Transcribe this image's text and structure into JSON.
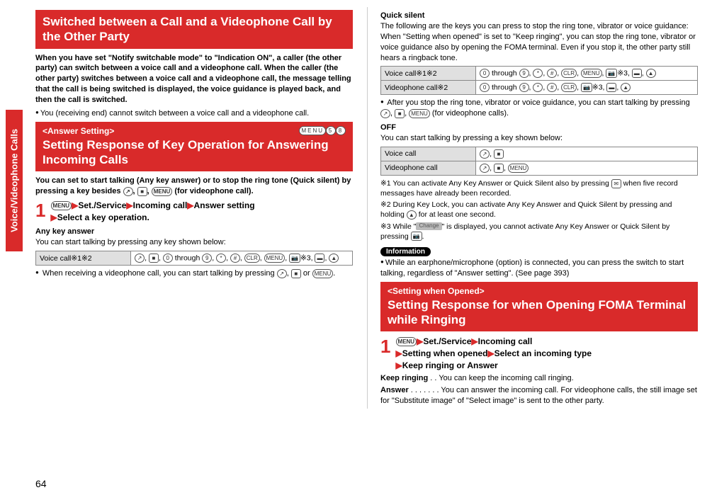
{
  "side_tab": "Voice/Videophone Calls",
  "page_number": "64",
  "left": {
    "heading1": "Switched between a Call and a Videophone Call by the Other Party",
    "intro1": "When you have set \"Notify switchable mode\" to \"Indication ON\", a caller (the other party) can switch between a voice call and a videophone call. When the caller (the other party) switches between a voice call and a videophone call, the message telling that the call is being switched is displayed, the voice guidance is played back, and then the call is switched.",
    "bullet1": "You (receiving end) cannot switch between a voice call and a videophone call.",
    "tag2": "<Answer Setting>",
    "keycode2": "MENU 5 8",
    "heading2": "Setting Response of Key Operation for Answering Incoming Calls",
    "lead2": "You can set to start talking (Any key answer) or to stop the ring tone (Quick silent) by pressing a key besides ",
    "lead2b": " (for videophone call).",
    "step1": "Set./Service",
    "step1b": "Incoming call",
    "step1c": "Answer setting",
    "step1d": "Select a key operation.",
    "sub_anykey": "Any key answer",
    "anykey_text": "You can start talking by pressing any key shown below:",
    "table_anykey_label": "Voice call※1※2",
    "anykey_bullet": "When receiving a videophone call, you can start talking by pressing "
  },
  "right": {
    "sub_quicksilent": "Quick silent",
    "qs_text1": "The following are the keys you can press to stop the ring tone, vibrator or voice guidance:",
    "qs_text2": "When \"Setting when opened\" is set to \"Keep ringing\", you can stop the ring tone, vibrator or voice guidance also by opening the FOMA terminal. Even if you stop it, the other party still hears a ringback tone.",
    "qs_table_r1": "Voice call※1※2",
    "qs_table_r2": "Videophone call※2",
    "qs_bullet": "After you stop the ring tone, vibrator or voice guidance, you can start talking by pressing ",
    "qs_bullet_b": " (for videophone calls).",
    "sub_off": "OFF",
    "off_text": "You can start talking by pressing a key shown below:",
    "off_table_r1": "Voice call",
    "off_table_r2": "Videophone call",
    "note1": "※1  You can activate Any Key Answer or Quick Silent also by pressing ",
    "note1b": " when five record messages have already been recorded.",
    "note2": "※2  During Key Lock, you can activate Any Key Answer and Quick Silent by pressing and holding ",
    "note2b": " for at least one second.",
    "note3": "※3  While \"",
    "note3b": "\" is displayed, you cannot activate Any Key Answer or Quick Silent by pressing ",
    "info_label": "Information",
    "info_bullet": "While an earphone/microphone (option) is connected, you can press the switch to start talking, regardless of \"Answer setting\". (See page 393)",
    "tag3": "<Setting when Opened>",
    "heading3": "Setting Response for when Opening FOMA Terminal while Ringing",
    "step3a": "Set./Service",
    "step3b": "Incoming call",
    "step3c": "Setting when opened",
    "step3d": "Select an incoming type",
    "step3e": "Keep ringing or Answer",
    "dl_keep_label": "Keep ringing",
    "dl_keep_text": " . . You can keep the incoming call ringing.",
    "dl_ans_label": "Answer",
    "dl_ans_text": " . . . . . . . You can answer the incoming call. For videophone calls, the still image set for \"Substitute image\" of \"Select image\" is sent to the other party.",
    "change_badge": "Change"
  }
}
